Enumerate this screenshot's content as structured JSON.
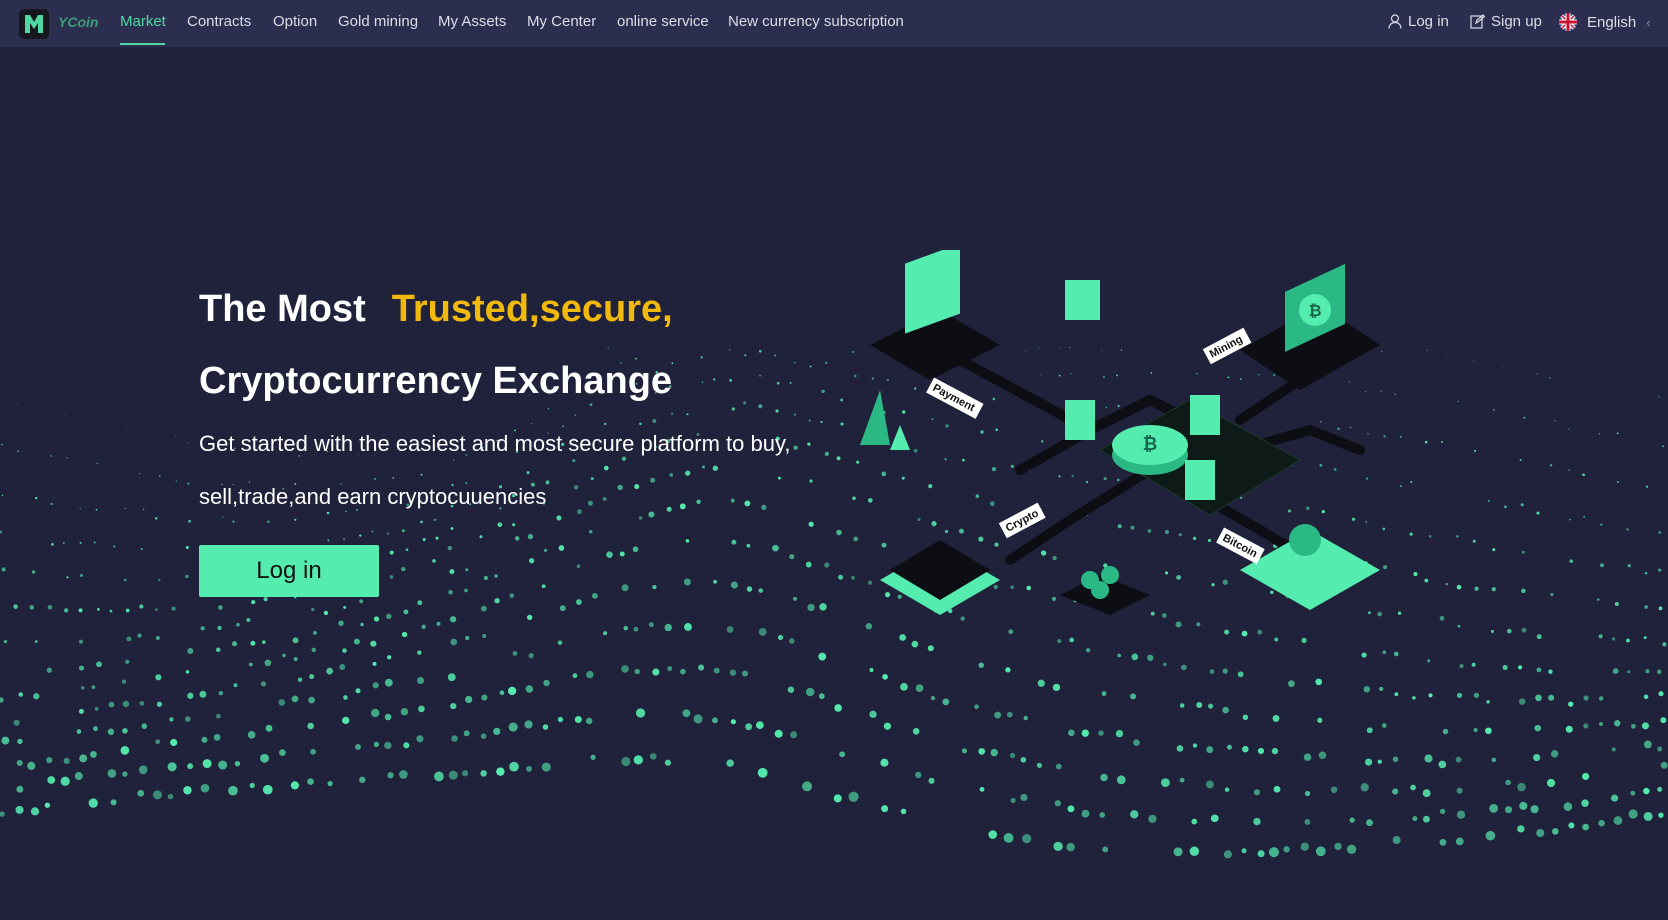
{
  "brand": {
    "name": "YCoin",
    "accent": "#4fd8a3"
  },
  "nav": {
    "items": [
      {
        "label": "Market",
        "active": true
      },
      {
        "label": "Contracts"
      },
      {
        "label": "Option"
      },
      {
        "label": "Gold mining"
      },
      {
        "label": "My Assets"
      },
      {
        "label": "My Center"
      },
      {
        "label": "online service"
      },
      {
        "label": "New currency subscription"
      }
    ],
    "login": "Log in",
    "signup": "Sign up",
    "language": "English"
  },
  "hero": {
    "title_white": "The Most",
    "title_highlight": "Trusted,secure,",
    "title_line2": "Cryptocurrency Exchange",
    "sub_line1": "Get started with the easiest and most secure platform to buy,",
    "sub_line2": "sell,trade,and earn cryptocuuencies",
    "cta": "Log in",
    "highlight_color": "#f0b90b"
  },
  "illustration": {
    "labels": [
      "Payment",
      "Mining",
      "Crypto",
      "Bitcoin"
    ]
  }
}
